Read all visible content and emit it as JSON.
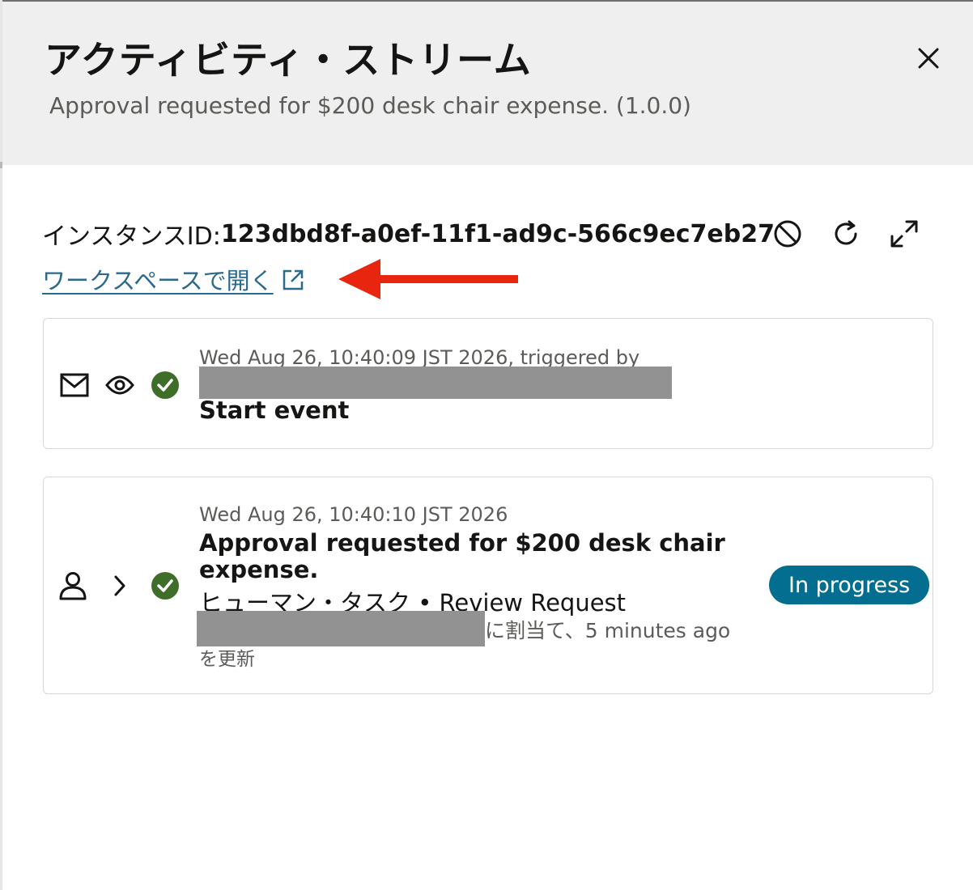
{
  "colors": {
    "header_bg": "#efefef",
    "link": "#2b6a8c",
    "success": "#3f6e2a",
    "badge_bg": "#036e8f",
    "annotation_arrow": "#e8260f",
    "redaction": "#929292"
  },
  "header": {
    "title": "アクティビティ・ストリーム",
    "subtitle": "Approval requested for $200 desk chair expense. (1.0.0)",
    "close_icon": "close-icon"
  },
  "instance": {
    "label": "インスタンスID: ",
    "value": "123dbd8f-a0ef-11f1-ad9c-566c9ec7eb27"
  },
  "toolbar": {
    "icons": [
      "cancel-circle-icon",
      "refresh-icon",
      "expand-icon"
    ]
  },
  "workspace_link": {
    "label": "ワークスペースで開く",
    "icon": "external-link-icon"
  },
  "activities": [
    {
      "icons": [
        "mail-icon",
        "eye-icon",
        "check-circle-icon"
      ],
      "timestamp": "Wed Aug 26, 10:40:09 JST 2026, triggered by",
      "title": "Start event"
    },
    {
      "icons": [
        "user-icon",
        "chevron-right-icon",
        "check-circle-icon"
      ],
      "timestamp": "Wed Aug 26, 10:40:10 JST 2026",
      "title_line1": "Approval requested for $200 desk chair",
      "title_line2": "expense.",
      "task_line": "ヒューマン・タスク • Review Request",
      "assigned": "に割当て、5 minutes ago",
      "updated": "を更新",
      "status": "In progress"
    }
  ]
}
